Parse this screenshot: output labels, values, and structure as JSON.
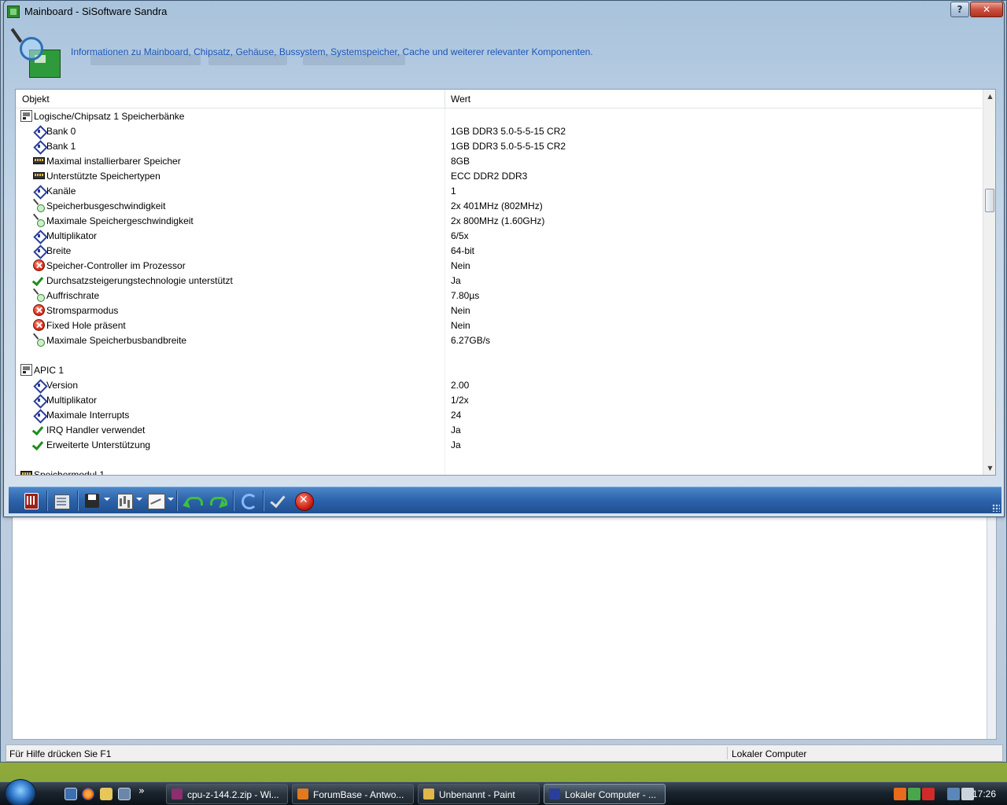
{
  "window": {
    "title": "Mainboard - SiSoftware Sandra",
    "help_label": "?",
    "close_label": "✕",
    "description": "Informationen zu Mainboard, Chipsatz, Gehäuse, Bussystem, Systemspeicher, Cache und weiterer relevanter Komponenten."
  },
  "list": {
    "col_object": "Objekt",
    "col_value": "Wert",
    "rows": [
      {
        "label": "Logische/Chipsatz 1 Speicherbänke",
        "value": "",
        "icon": "group-icon"
      },
      {
        "label": "Bank 0",
        "value": "1GB DDR3 5.0-5-5-15 CR2",
        "icon": "diamond-icon"
      },
      {
        "label": "Bank 1",
        "value": "1GB DDR3 5.0-5-5-15 CR2",
        "icon": "diamond-icon"
      },
      {
        "label": "Maximal installierbarer Speicher",
        "value": "8GB",
        "icon": "memory-module-icon"
      },
      {
        "label": "Unterstützte Speichertypen",
        "value": " ECC DDR2 DDR3",
        "icon": "memory-module-icon"
      },
      {
        "label": "Kanäle",
        "value": "1",
        "icon": "diamond-icon"
      },
      {
        "label": "Speicherbusgeschwindigkeit",
        "value": "2x 401MHz (802MHz)",
        "icon": "gauge-icon"
      },
      {
        "label": "Maximale Speichergeschwindigkeit",
        "value": "2x 800MHz (1.60GHz)",
        "icon": "gauge-icon"
      },
      {
        "label": "Multiplikator",
        "value": "6/5x",
        "icon": "diamond-icon"
      },
      {
        "label": "Breite",
        "value": "64-bit",
        "icon": "diamond-icon"
      },
      {
        "label": "Speicher-Controller im Prozessor",
        "value": "Nein",
        "icon": "no-icon"
      },
      {
        "label": "Durchsatzsteigerungstechnologie unterstützt",
        "value": "Ja",
        "icon": "check-icon"
      },
      {
        "label": "Auffrischrate",
        "value": "7.80µs",
        "icon": "gauge-icon"
      },
      {
        "label": "Stromsparmodus",
        "value": "Nein",
        "icon": "no-icon"
      },
      {
        "label": "Fixed Hole präsent",
        "value": "Nein",
        "icon": "no-icon"
      },
      {
        "label": "Maximale Speicherbusbandbreite",
        "value": "6.27GB/s",
        "icon": "gauge-icon"
      },
      {
        "label": "",
        "value": "",
        "icon": ""
      },
      {
        "label": "APIC 1",
        "value": "",
        "icon": "group-icon"
      },
      {
        "label": "Version",
        "value": "2.00",
        "icon": "diamond-icon"
      },
      {
        "label": "Multiplikator",
        "value": "1/2x",
        "icon": "diamond-icon"
      },
      {
        "label": "Maximale Interrupts",
        "value": "24",
        "icon": "diamond-icon"
      },
      {
        "label": "IRQ Handler verwendet",
        "value": "Ja",
        "icon": "check-icon"
      },
      {
        "label": "Erweiterte Unterstützung",
        "value": "Ja",
        "icon": "check-icon"
      },
      {
        "label": "",
        "value": "",
        "icon": ""
      },
      {
        "label": "Speichermodul 1",
        "value": "",
        "icon": "memory-module-icon"
      }
    ]
  },
  "statusbar": {
    "help_text": "Für Hilfe drücken Sie F1",
    "location": "Lokaler Computer"
  },
  "taskbar": {
    "more": "»",
    "tasks": [
      {
        "label": "cpu-z-144.2.zip - Wi...",
        "active": false,
        "color": "#8b2f6e"
      },
      {
        "label": "ForumBase - Antwo...",
        "active": false,
        "color": "#e07a1f"
      },
      {
        "label": "Unbenannt - Paint",
        "active": false,
        "color": "#e0b84a"
      },
      {
        "label": "Lokaler Computer - ...",
        "active": true,
        "color": "#2a3f9a"
      }
    ],
    "clock": "17:26"
  },
  "colors": {
    "accent_blue": "#2c63ab",
    "description_text": "#1d55b8"
  }
}
